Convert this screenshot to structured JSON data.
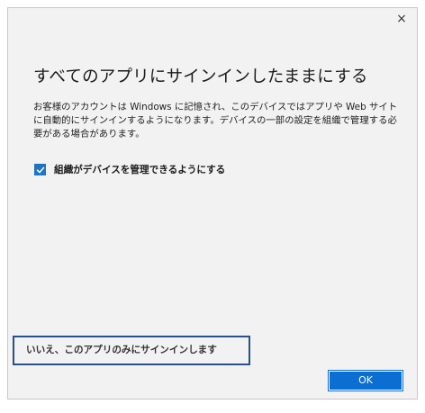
{
  "dialog": {
    "close_glyph": "×",
    "heading": "すべてのアプリにサインインしたままにする",
    "description": "お客様のアカウントは Windows に記憶され、このデバイスではアプリや Web サイトに自動的にサインインするようになります。デバイスの一部の設定を組織で管理する必要がある場合があります。",
    "checkbox": {
      "label": "組織がデバイスを管理できるようにする",
      "checked": true
    },
    "alt_link": "いいえ、このアプリのみにサインインします",
    "ok_label": "OK"
  },
  "colors": {
    "accent": "#0a6fd1",
    "focus_border": "#2b4f8a",
    "dialog_background": "#f2f2f2"
  },
  "icons": {
    "close": "close-icon",
    "checkmark": "checkmark-icon"
  }
}
